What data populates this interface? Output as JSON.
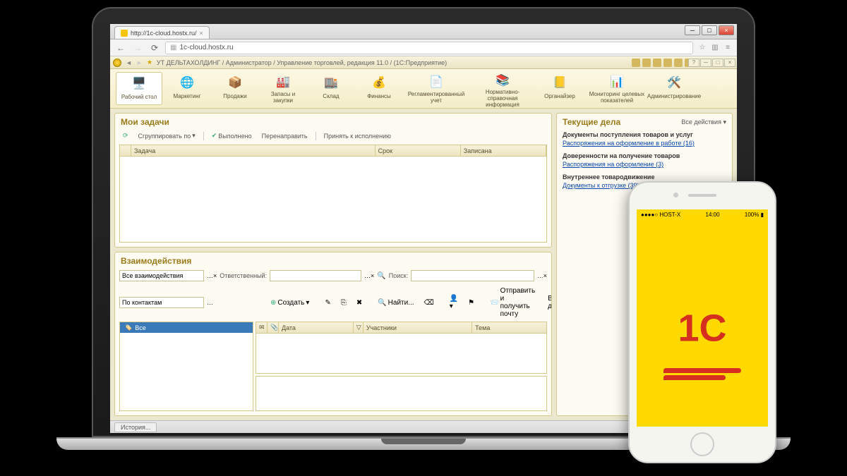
{
  "browser": {
    "tab_title": "http://1c-cloud.hostx.ru/",
    "url": "1c-cloud.hostx.ru"
  },
  "app": {
    "title": "УТ ДЕЛЬТАХОЛДИНГ / Администратор / Управление торговлей, редакция 11.0 / (1С:Предприятие)"
  },
  "toolbar": {
    "items": [
      {
        "label": "Рабочий\nстол"
      },
      {
        "label": "Маркетинг"
      },
      {
        "label": "Продажи"
      },
      {
        "label": "Запасы и\nзакупки"
      },
      {
        "label": "Склад"
      },
      {
        "label": "Финансы"
      },
      {
        "label": "Регламентированный\nучет"
      },
      {
        "label": "Нормативно-справочная\nинформация"
      },
      {
        "label": "Органайзер"
      },
      {
        "label": "Мониторинг целевых\nпоказателей"
      },
      {
        "label": "Администрирование"
      }
    ]
  },
  "tasks": {
    "title": "Мои задачи",
    "toolbar": {
      "group_by": "Сгруппировать по",
      "done": "Выполнено",
      "redirect": "Перенаправить",
      "accept": "Принять к исполнению"
    },
    "columns": {
      "task": "Задача",
      "deadline": "Срок",
      "written": "Записана"
    }
  },
  "interactions": {
    "title": "Взаимодействия",
    "filter_all": "Все взаимодействия",
    "responsible_label": "Ответственный:",
    "search_label": "Поиск:",
    "contacts_label": "По контактам",
    "toolbar": {
      "create": "Создать",
      "find": "Найти...",
      "send_receive": "Отправить и получить почту",
      "all_actions": "Все действия"
    },
    "tree_root": "Все",
    "grid_columns": {
      "date": "Дата",
      "participants": "Участники",
      "subject": "Тема"
    }
  },
  "current": {
    "title": "Текущие дела",
    "all_actions": "Все действия",
    "blocks": [
      {
        "title": "Документы поступления товаров и услуг",
        "link": "Распоряжения на оформление в работе (16)"
      },
      {
        "title": "Доверенности на получение товаров",
        "link": "Распоряжения на оформление (3)"
      },
      {
        "title": "Внутреннее товародвижение",
        "link": "Документы к отгрузке (39)"
      }
    ]
  },
  "statusbar": {
    "history": "История..."
  },
  "phone": {
    "carrier": "●●●●○ HOST-X",
    "wifi": "⚞",
    "time": "14:00",
    "battery": "100%",
    "logo": "1C"
  }
}
